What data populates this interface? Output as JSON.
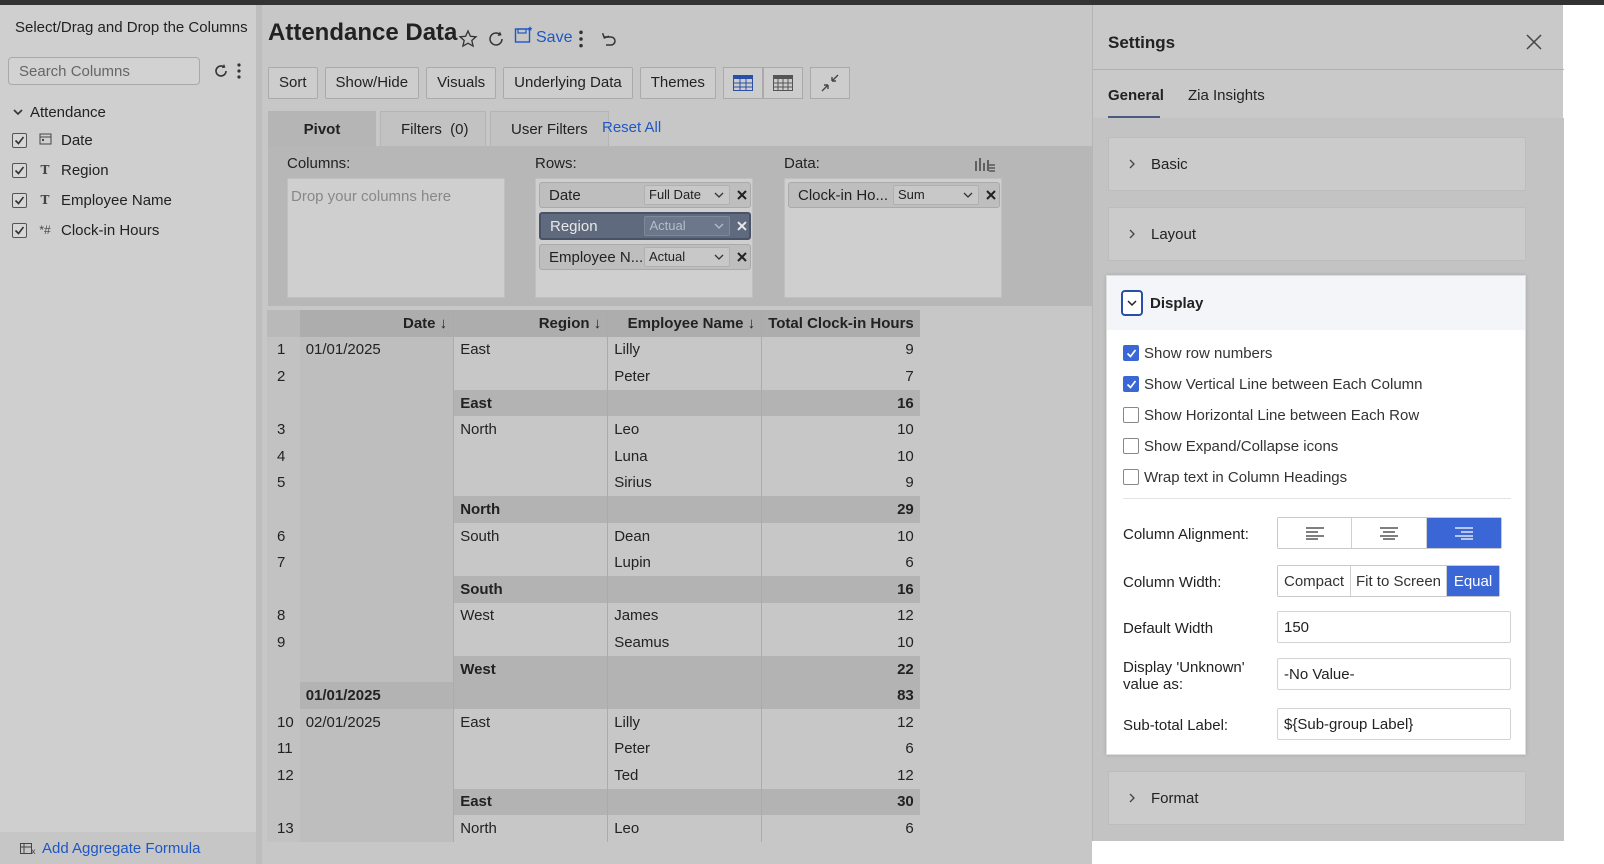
{
  "left_panel": {
    "title": "Select/Drag and Drop the Columns",
    "search_placeholder": "Search Columns",
    "group": {
      "label": "Attendance",
      "fields": [
        {
          "label": "Date",
          "type": "calendar-icon"
        },
        {
          "label": "Region",
          "type": "text-type-icon"
        },
        {
          "label": "Employee Name",
          "type": "text-type-icon"
        },
        {
          "label": "Clock-in Hours",
          "type": "number-type-icon"
        }
      ]
    },
    "footer_link": "Add Aggregate Formula"
  },
  "header": {
    "title": "Attendance Data",
    "save_label": "Save"
  },
  "toolbar": {
    "buttons": [
      "Sort",
      "Show/Hide",
      "Visuals",
      "Underlying Data",
      "Themes"
    ]
  },
  "pivot_tabs": {
    "pivot": "Pivot",
    "filters": "Filters  (0)",
    "user_filters": "User Filters",
    "reset_all": "Reset All"
  },
  "pivot_config": {
    "columns_label": "Columns:",
    "columns_placeholder": "Drop your columns here",
    "rows_label": "Rows:",
    "rows": [
      {
        "name": "Date",
        "option": "Full Date"
      },
      {
        "name": "Region",
        "option": "Actual"
      },
      {
        "name": "Employee N...",
        "option": "Actual"
      }
    ],
    "data_label": "Data:",
    "data": [
      {
        "name": "Clock-in Ho...",
        "option": "Sum"
      }
    ]
  },
  "table": {
    "headers": [
      "Date ↓",
      "Region ↓",
      "Employee Name ↓",
      "Total Clock-in Hours"
    ],
    "rows": [
      {
        "n": "1",
        "date": "01/01/2025",
        "region": "East",
        "emp": "Lilly",
        "val": "9",
        "kind": ""
      },
      {
        "n": "2",
        "date": "",
        "region": "",
        "emp": "Peter",
        "val": "7",
        "kind": ""
      },
      {
        "n": "",
        "date": "",
        "region": "East",
        "emp": "",
        "val": "16",
        "kind": "sub"
      },
      {
        "n": "3",
        "date": "",
        "region": "North",
        "emp": "Leo",
        "val": "10",
        "kind": ""
      },
      {
        "n": "4",
        "date": "",
        "region": "",
        "emp": "Luna",
        "val": "10",
        "kind": ""
      },
      {
        "n": "5",
        "date": "",
        "region": "",
        "emp": "Sirius",
        "val": "9",
        "kind": ""
      },
      {
        "n": "",
        "date": "",
        "region": "North",
        "emp": "",
        "val": "29",
        "kind": "sub"
      },
      {
        "n": "6",
        "date": "",
        "region": "South",
        "emp": "Dean",
        "val": "10",
        "kind": ""
      },
      {
        "n": "7",
        "date": "",
        "region": "",
        "emp": "Lupin",
        "val": "6",
        "kind": ""
      },
      {
        "n": "",
        "date": "",
        "region": "South",
        "emp": "",
        "val": "16",
        "kind": "sub"
      },
      {
        "n": "8",
        "date": "",
        "region": "West",
        "emp": "James",
        "val": "12",
        "kind": ""
      },
      {
        "n": "9",
        "date": "",
        "region": "",
        "emp": "Seamus",
        "val": "10",
        "kind": ""
      },
      {
        "n": "",
        "date": "",
        "region": "West",
        "emp": "",
        "val": "22",
        "kind": "sub"
      },
      {
        "n": "",
        "date": "01/01/2025",
        "region": "",
        "emp": "",
        "val": "83",
        "kind": "sub2"
      },
      {
        "n": "10",
        "date": "02/01/2025",
        "region": "East",
        "emp": "Lilly",
        "val": "12",
        "kind": ""
      },
      {
        "n": "11",
        "date": "",
        "region": "",
        "emp": "Peter",
        "val": "6",
        "kind": ""
      },
      {
        "n": "12",
        "date": "",
        "region": "",
        "emp": "Ted",
        "val": "12",
        "kind": ""
      },
      {
        "n": "",
        "date": "",
        "region": "East",
        "emp": "",
        "val": "30",
        "kind": "sub"
      },
      {
        "n": "13",
        "date": "",
        "region": "North",
        "emp": "Leo",
        "val": "6",
        "kind": ""
      }
    ]
  },
  "settings": {
    "title": "Settings",
    "tabs": [
      "General",
      "Zia Insights"
    ],
    "sections": {
      "basic": "Basic",
      "layout": "Layout",
      "display": "Display",
      "format": "Format"
    },
    "display": {
      "options": [
        {
          "label": "Show row numbers",
          "checked": true
        },
        {
          "label": "Show Vertical Line between Each Column",
          "checked": true
        },
        {
          "label": "Show Horizontal Line between Each Row",
          "checked": false
        },
        {
          "label": "Show Expand/Collapse icons",
          "checked": false
        },
        {
          "label": "Wrap text in Column Headings",
          "checked": false
        }
      ],
      "column_alignment_label": "Column Alignment:",
      "column_alignment_selected": "right",
      "column_width_label": "Column Width:",
      "column_width_options": [
        "Compact",
        "Fit to Screen",
        "Equal"
      ],
      "column_width_selected": "Equal",
      "default_width_label": "Default Width",
      "default_width_value": "150",
      "unknown_label_line1": "Display 'Unknown'",
      "unknown_label_line2": "value as:",
      "unknown_value": "-No Value-",
      "subtotal_label": "Sub-total Label:",
      "subtotal_value": "${Sub-group Label}"
    }
  },
  "colors": {
    "accent": "#3b66d6",
    "link": "#1f57c3"
  }
}
